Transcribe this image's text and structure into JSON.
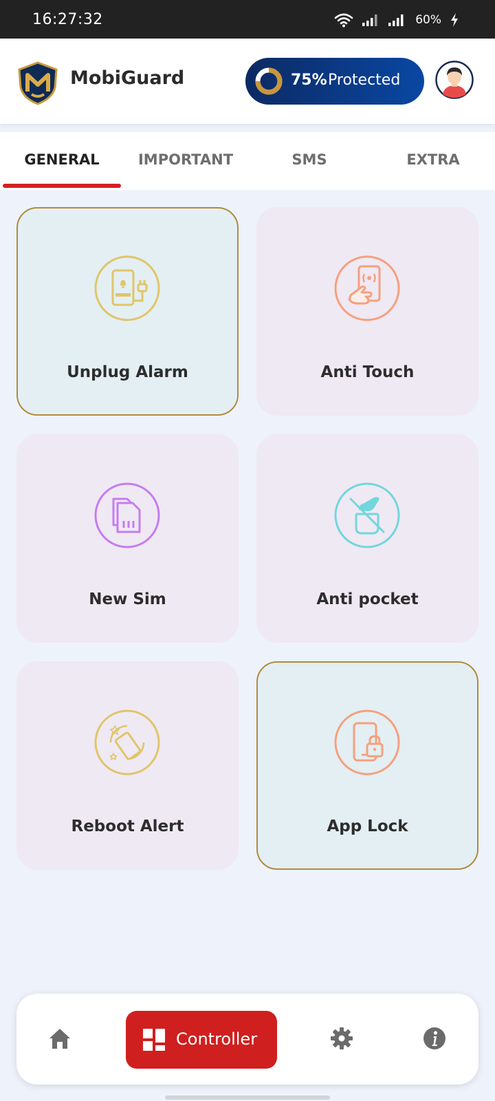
{
  "status_bar": {
    "time": "16:27:32",
    "battery": "60%",
    "icons": [
      "wifi-icon",
      "signal-icon",
      "signal-icon",
      "battery-charging-icon"
    ]
  },
  "header": {
    "app_name": "MobiGuard",
    "protection_percent": "75%",
    "protection_label": "Protected",
    "protection_level": 0.75,
    "logo_icon": "shield-m-logo",
    "avatar_icon": "user-avatar"
  },
  "tabs": [
    {
      "label": "GENERAL",
      "active": true
    },
    {
      "label": "IMPORTANT",
      "active": false
    },
    {
      "label": "SMS",
      "active": false
    },
    {
      "label": "EXTRA",
      "active": false
    }
  ],
  "cards": [
    {
      "label": "Unplug Alarm",
      "icon": "unplug-alarm-icon",
      "active": true,
      "icon_color": "#e0c56a"
    },
    {
      "label": "Anti Touch",
      "icon": "anti-touch-icon",
      "active": false,
      "icon_color": "#f5a07e"
    },
    {
      "label": "New Sim",
      "icon": "sim-card-icon",
      "active": false,
      "icon_color": "#c57cf0"
    },
    {
      "label": "Anti pocket",
      "icon": "anti-pocket-icon",
      "active": false,
      "icon_color": "#73d6dc"
    },
    {
      "label": "Reboot Alert",
      "icon": "reboot-alert-icon",
      "active": false,
      "icon_color": "#e0c56a"
    },
    {
      "label": "App Lock",
      "icon": "app-lock-icon",
      "active": true,
      "icon_color": "#f5a07e"
    }
  ],
  "bottom_nav": {
    "items": [
      "home-icon",
      "controller",
      "settings-icon",
      "info-icon"
    ],
    "controller_label": "Controller"
  },
  "colors": {
    "accent_red": "#d01f1f",
    "header_blue": "#0a47a3",
    "card_bg": "#efe9f3",
    "card_active_bg": "#e4eff3",
    "card_active_border": "#b08a3e",
    "page_bg": "#eef2fb"
  }
}
